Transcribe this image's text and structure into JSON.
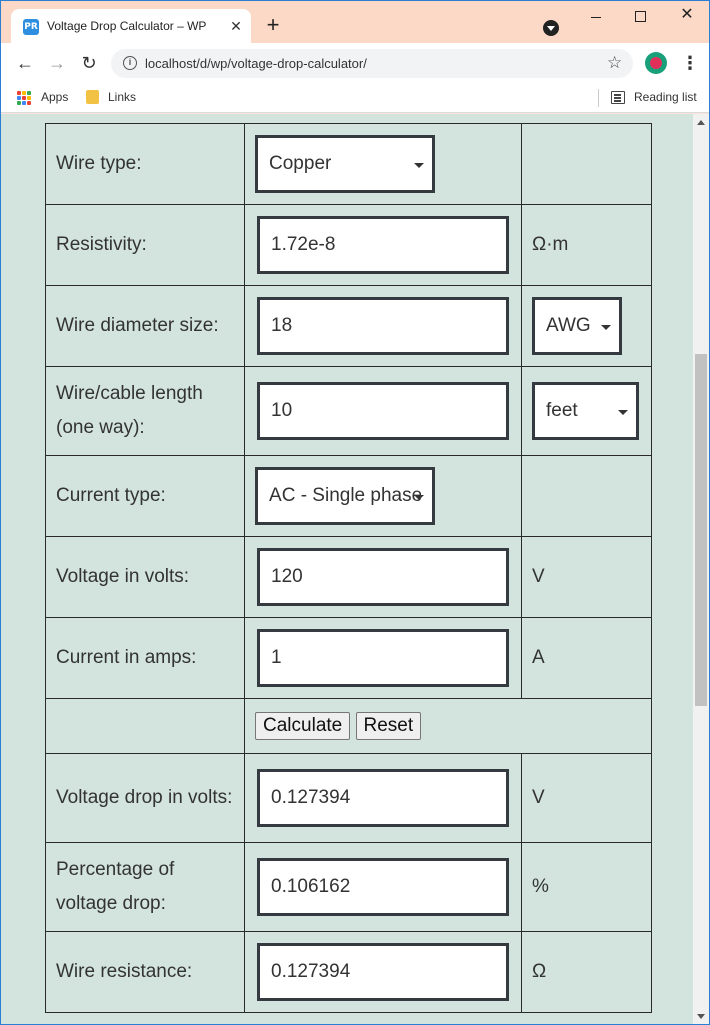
{
  "browser": {
    "tab_title": "Voltage Drop Calculator – WP",
    "tab_favicon_text": "PR",
    "new_tab_glyph": "+",
    "close_glyph": "✕",
    "url": "localhost/d/wp/voltage-drop-calculator/",
    "bookmarks": [
      {
        "label": "Apps",
        "icon": "apps-grid-icon"
      },
      {
        "label": "Links",
        "icon": "folder-icon"
      }
    ],
    "reading_list_label": "Reading list",
    "accent_color": "#2a7fd4",
    "tabstrip_color": "#fbd9c6"
  },
  "page": {
    "background_color": "#d3e4de",
    "rows": [
      {
        "label": "Wire type:",
        "control": "select",
        "value": "Copper",
        "unit": ""
      },
      {
        "label": "Resistivity:",
        "control": "input",
        "value": "1.72e-8",
        "unit": "Ω·m"
      },
      {
        "label": "Wire diameter size:",
        "control": "input",
        "value": "18",
        "unit_select": "AWG"
      },
      {
        "label": "Wire/cable length (one way):",
        "control": "input",
        "value": "10",
        "unit_select": "feet"
      },
      {
        "label": "Current type:",
        "control": "select",
        "value": "AC - Single phase",
        "unit": ""
      },
      {
        "label": "Voltage in volts:",
        "control": "input",
        "value": "120",
        "unit": "V"
      },
      {
        "label": "Current in amps:",
        "control": "input",
        "value": "1",
        "unit": "A"
      }
    ],
    "buttons": {
      "calculate": "Calculate",
      "reset": "Reset"
    },
    "results": [
      {
        "label": "Voltage drop in volts:",
        "value": "0.127394",
        "unit": "V"
      },
      {
        "label": "Percentage of voltage drop:",
        "value": "0.106162",
        "unit": "%"
      },
      {
        "label": "Wire resistance:",
        "value": "0.127394",
        "unit": "Ω"
      }
    ]
  }
}
